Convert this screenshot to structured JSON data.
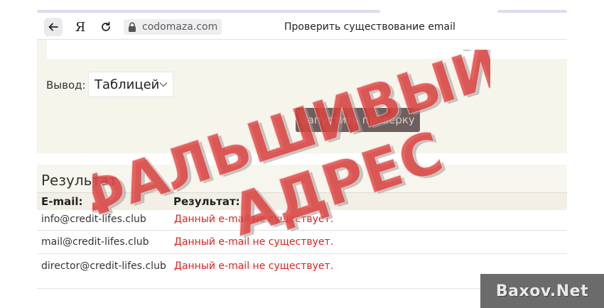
{
  "browser": {
    "ya_label": "Я",
    "url": "codomaza.com",
    "page_title": "Проверить существование email"
  },
  "form": {
    "output_label": "Вывод:",
    "output_selected": "Таблицей",
    "run_button": "Запустить проверку"
  },
  "results": {
    "title": "Результат",
    "columns": [
      "E-mail:",
      "Результат:"
    ],
    "rows": [
      {
        "email": "info@credit-lifes.club",
        "result": "Данный e-mail не существует."
      },
      {
        "email": "mail@credit-lifes.club",
        "result": "Данный e-mail не существует."
      },
      {
        "email": "director@credit-lifes.club",
        "result": "Данный e-mail не существует."
      }
    ]
  },
  "stamp": {
    "line1": "ФАЛЬШИВЫЙ",
    "line2": "АДРЕС",
    "color": "#e03a37"
  },
  "watermark": {
    "text": "Baxov.Net"
  },
  "icons": {
    "back": "arrow-left-icon",
    "reload": "reload-icon",
    "lock": "lock-icon",
    "select": "chevron-down-icon"
  }
}
